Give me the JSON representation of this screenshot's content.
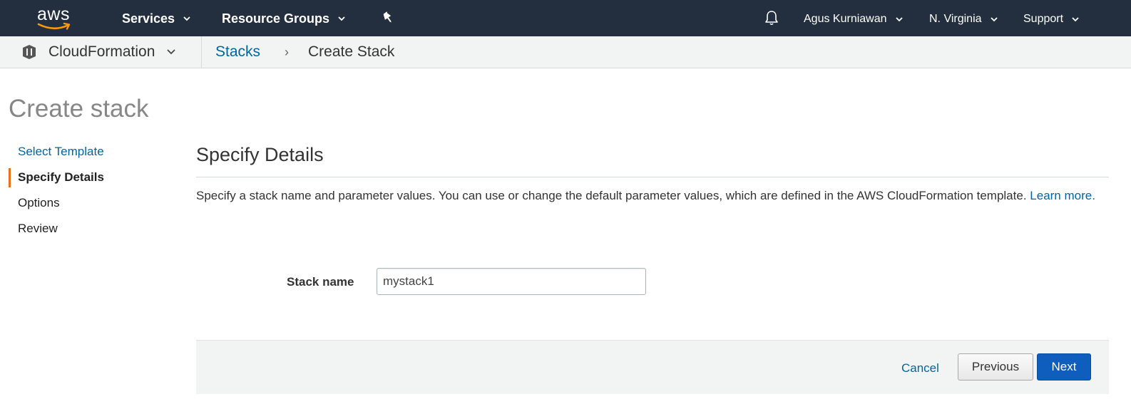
{
  "topnav": {
    "logo_text": "aws",
    "services_label": "Services",
    "resource_groups_label": "Resource Groups",
    "user_label": "Agus Kurniawan",
    "region_label": "N. Virginia",
    "support_label": "Support",
    "icons": [
      "aws-logo",
      "chevron-down-icon",
      "pin-icon",
      "bell-icon"
    ],
    "background_color": "#232f3e"
  },
  "subnav": {
    "service_name": "CloudFormation",
    "breadcrumb": {
      "link": "Stacks",
      "separator": "›",
      "current": "Create Stack"
    }
  },
  "page": {
    "title": "Create stack"
  },
  "steps": [
    {
      "label": "Select Template",
      "state": "link"
    },
    {
      "label": "Specify Details",
      "state": "active"
    },
    {
      "label": "Options",
      "state": "upcoming"
    },
    {
      "label": "Review",
      "state": "upcoming"
    }
  ],
  "main": {
    "section_title": "Specify Details",
    "description": "Specify a stack name and parameter values. You can use or change the default parameter values, which are defined in the AWS CloudFormation template.",
    "learn_more": "Learn more.",
    "stack_name_label": "Stack name",
    "stack_name_value": "mystack1"
  },
  "footer": {
    "cancel_label": "Cancel",
    "previous_label": "Previous",
    "next_label": "Next"
  },
  "colors": {
    "accent_orange": "#ec7211",
    "link_blue": "#0066a1",
    "primary_button": "#0f5ebd"
  }
}
